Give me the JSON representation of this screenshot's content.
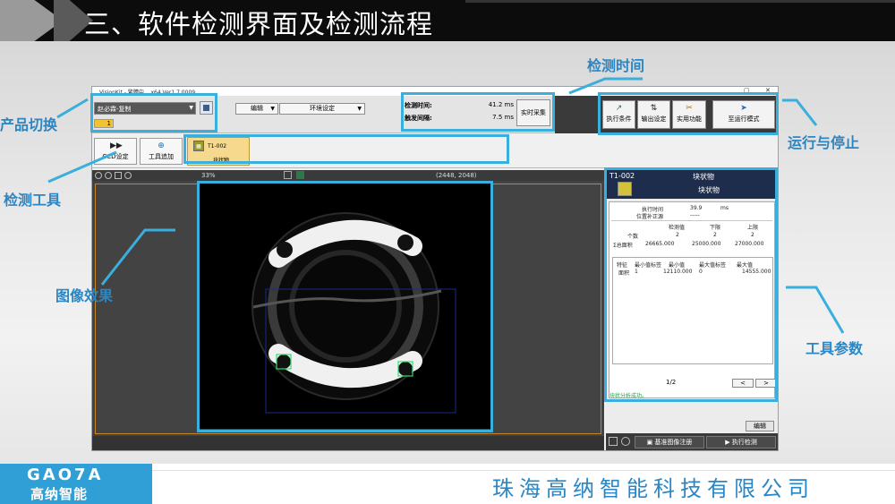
{
  "slide": {
    "title": "三、软件检测界面及检测流程",
    "footer_logo_text": "GAO7A",
    "footer_brand": "高纳智能",
    "footer_company": "珠海高纳智能科技有限公司"
  },
  "annotations": {
    "product_switch": "产品切换",
    "detection_tool": "检测工具",
    "image_effect": "图像效果",
    "detection_time": "检测时间",
    "run_stop": "运行与停止",
    "tool_params": "工具参数"
  },
  "window": {
    "title": "VisionKit - 繁體中... x64 Ver1.7.0009",
    "controls": [
      "▁",
      "▢",
      "✕"
    ]
  },
  "toolbar": {
    "product_select": "赵必霖-复制",
    "product_tag": "1",
    "edit_menu": "编辑",
    "env_menu": "环境设定",
    "detect_time_label": "检测时间:",
    "detect_time_value": "41.2 ms",
    "trigger_interval_label": "触发间隔:",
    "trigger_interval_value": "7.5 ms",
    "live_capture": "实时采集",
    "exec_condition": "执行条件",
    "output_setting": "输出设定",
    "utility": "实用功能",
    "run_mode": "至运行模式"
  },
  "tools": {
    "ccd_setting": "CCD设定",
    "add_tool": "工具追加",
    "item_id": "T1-002",
    "item_name": "块状物"
  },
  "image": {
    "zoom": "33%",
    "resolution": "(2448, 2048)"
  },
  "panel": {
    "tool_id": "T1-002",
    "tool_name": "块状物",
    "tool_sub": "块状物",
    "exec_time_label": "执行时间",
    "exec_time_value": "39.9",
    "exec_time_unit": "ms",
    "pos_correct_label": "位置补正源",
    "pos_correct_value": "-----",
    "col_detect": "检测值",
    "col_lower": "下限",
    "col_upper": "上限",
    "row_count": "个数",
    "count_detect": "2",
    "count_lower": "2",
    "count_upper": "2",
    "row_area": "Σ总面积",
    "area_detect": "26665.000",
    "area_lower": "25000.000",
    "area_upper": "27000.000",
    "t_feature": "特征",
    "t_min_label": "最小值标签",
    "t_min": "最小值",
    "t_max_label": "最大值标签",
    "t_max": "最大值",
    "r_feature": "面积",
    "r_min_label": "1",
    "r_min": "12110.000",
    "r_max_label": "0",
    "r_max": "14555.000",
    "page": "1/2",
    "prev": "<",
    "next": ">",
    "status_msg": "块状分析成功。",
    "edit": "编辑",
    "ref_image": "基准图像注册",
    "exec_detect": "执行检测"
  },
  "colors": {
    "highlight": "#3aaedc",
    "annotation_text": "#2a86c4",
    "brand_blue": "#2f9fd5"
  }
}
